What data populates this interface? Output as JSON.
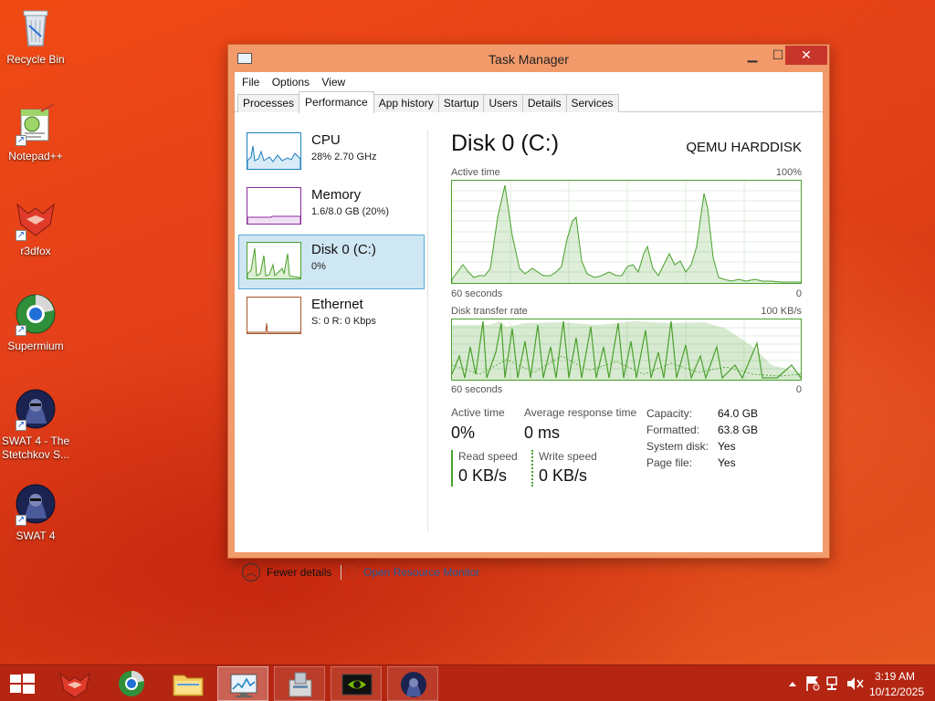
{
  "desktop": {
    "icons": [
      {
        "label": "Recycle Bin"
      },
      {
        "label": "Notepad++"
      },
      {
        "label": "r3dfox"
      },
      {
        "label": "Supermium"
      },
      {
        "label": "SWAT 4 - The Stetchkov S..."
      },
      {
        "label": "SWAT 4"
      }
    ]
  },
  "window": {
    "title": "Task Manager",
    "controls": {
      "minimize": "▁",
      "maximize": "☐",
      "close": "✕"
    },
    "menu": [
      "File",
      "Options",
      "View"
    ],
    "tabs": [
      "Processes",
      "Performance",
      "App history",
      "Startup",
      "Users",
      "Details",
      "Services"
    ],
    "active_tab": "Performance"
  },
  "sidebar": {
    "items": [
      {
        "name": "CPU",
        "sub": "28% 2.70 GHz",
        "color": "#1b7fbf"
      },
      {
        "name": "Memory",
        "sub": "1.6/8.0 GB (20%)",
        "color": "#8b2b9c"
      },
      {
        "name": "Disk 0 (C:)",
        "sub": "0%",
        "color": "#4aa02c",
        "selected": true
      },
      {
        "name": "Ethernet",
        "sub": "S: 0 R: 0 Kbps",
        "color": "#a7562a"
      }
    ]
  },
  "main": {
    "title": "Disk 0 (C:)",
    "model": "QEMU HARDDISK",
    "active_time_label": "Active time",
    "active_time_max": "100%",
    "active_time_xlabel": "60 seconds",
    "active_time_min": "0",
    "transfer_label": "Disk transfer rate",
    "transfer_max": "100 KB/s",
    "transfer_xlabel": "60 seconds",
    "transfer_min": "0",
    "accent": "#4aa02c",
    "stats": {
      "active_time_label": "Active time",
      "active_time_value": "0%",
      "avg_response_label": "Average response time",
      "avg_response_value": "0 ms",
      "read_label": "Read speed",
      "read_value": "0 KB/s",
      "write_label": "Write speed",
      "write_value": "0 KB/s"
    },
    "info": [
      {
        "label": "Capacity:",
        "value": "64.0 GB"
      },
      {
        "label": "Formatted:",
        "value": "63.8 GB"
      },
      {
        "label": "System disk:",
        "value": "Yes"
      },
      {
        "label": "Page file:",
        "value": "Yes"
      }
    ]
  },
  "footer": {
    "fewer_details": "Fewer details",
    "resource_monitor": "Open Resource Monitor"
  },
  "taskbar": {
    "time": "3:19 AM",
    "date": "10/12/2025"
  }
}
